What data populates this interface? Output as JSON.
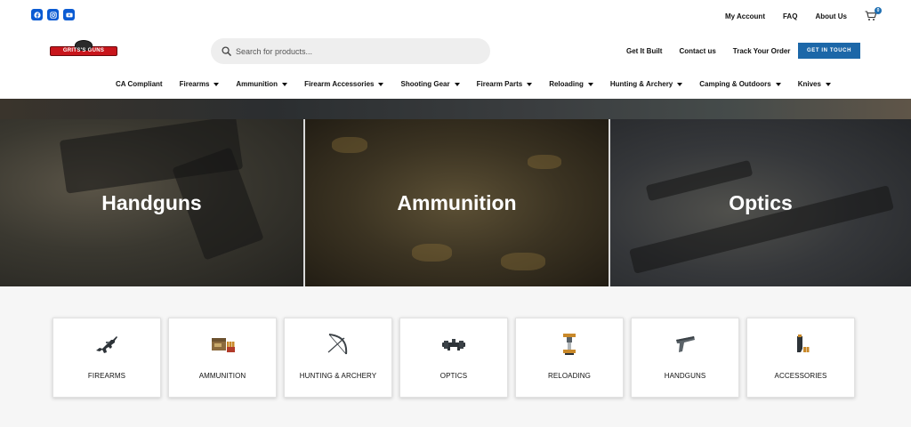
{
  "social": [
    {
      "icon": "facebook-icon"
    },
    {
      "icon": "instagram-icon"
    },
    {
      "icon": "youtube-icon"
    }
  ],
  "top_links": [
    "My Account",
    "FAQ",
    "About Us"
  ],
  "cart": {
    "count": "0",
    "icon": "cart-icon"
  },
  "logo": {
    "text": "GRITS'S GUNS"
  },
  "search": {
    "placeholder": "Search for products..."
  },
  "header_links": [
    "Get It Built",
    "Contact us",
    "Track Your Order"
  ],
  "cta": "GET IN TOUCH",
  "nav": [
    {
      "label": "CA Compliant",
      "dropdown": false
    },
    {
      "label": "Firearms",
      "dropdown": true
    },
    {
      "label": "Ammunition",
      "dropdown": true
    },
    {
      "label": "Firearm Accessories",
      "dropdown": true
    },
    {
      "label": "Shooting Gear",
      "dropdown": true
    },
    {
      "label": "Firearm Parts",
      "dropdown": true
    },
    {
      "label": "Reloading",
      "dropdown": true
    },
    {
      "label": "Hunting & Archery",
      "dropdown": true
    },
    {
      "label": "Camping & Outdoors",
      "dropdown": true
    },
    {
      "label": "Knives",
      "dropdown": true
    }
  ],
  "hero": [
    "Handguns",
    "Ammunition",
    "Optics"
  ],
  "categories": [
    {
      "label": "FIREARMS",
      "icon": "rifle-icon"
    },
    {
      "label": "AMMUNITION",
      "icon": "ammo-box-icon"
    },
    {
      "label": "HUNTING & ARCHERY",
      "icon": "bow-icon"
    },
    {
      "label": "OPTICS",
      "icon": "scope-icon"
    },
    {
      "label": "RELOADING",
      "icon": "reloading-press-icon"
    },
    {
      "label": "HANDGUNS",
      "icon": "pistol-icon"
    },
    {
      "label": "ACCESSORIES",
      "icon": "magazine-icon"
    }
  ],
  "colors": {
    "accent": "#1c67a8",
    "social": "#0b5bd3",
    "logo_red": "#c8151b"
  }
}
